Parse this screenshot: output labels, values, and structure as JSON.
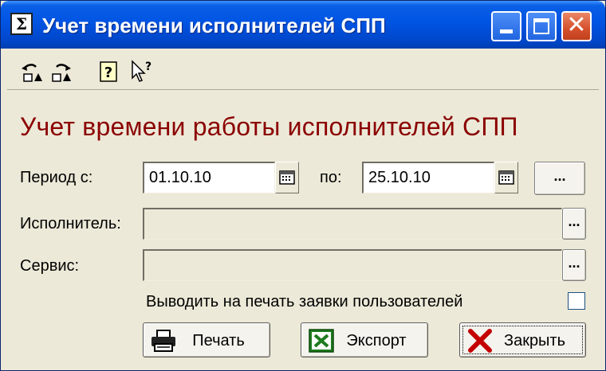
{
  "window": {
    "title": "Учет времени исполнителей СПП",
    "icon": "sigma-app-icon"
  },
  "titlebar_buttons": {
    "minimize": "minimize-icon",
    "maximize": "maximize-icon",
    "close": "close-icon"
  },
  "toolbar": {
    "tools": [
      "undo-icon",
      "redo-icon",
      "help-icon",
      "whats-this-help-icon"
    ]
  },
  "heading": "Учет времени работы исполнителей СПП",
  "form": {
    "period_from_label": "Период с:",
    "period_from_value": "01.10.10",
    "period_to_label": "по:",
    "period_to_value": "25.10.10",
    "period_select_label": "...",
    "executor_label": "Исполнитель:",
    "executor_value": "",
    "executor_browse_label": "...",
    "service_label": "Сервис:",
    "service_value": "",
    "service_browse_label": "...",
    "print_requests_label": "Выводить на печать заявки пользователей",
    "print_requests_checked": false
  },
  "actions": {
    "print_label": "Печать",
    "export_label": "Экспорт",
    "close_label": "Закрыть"
  }
}
